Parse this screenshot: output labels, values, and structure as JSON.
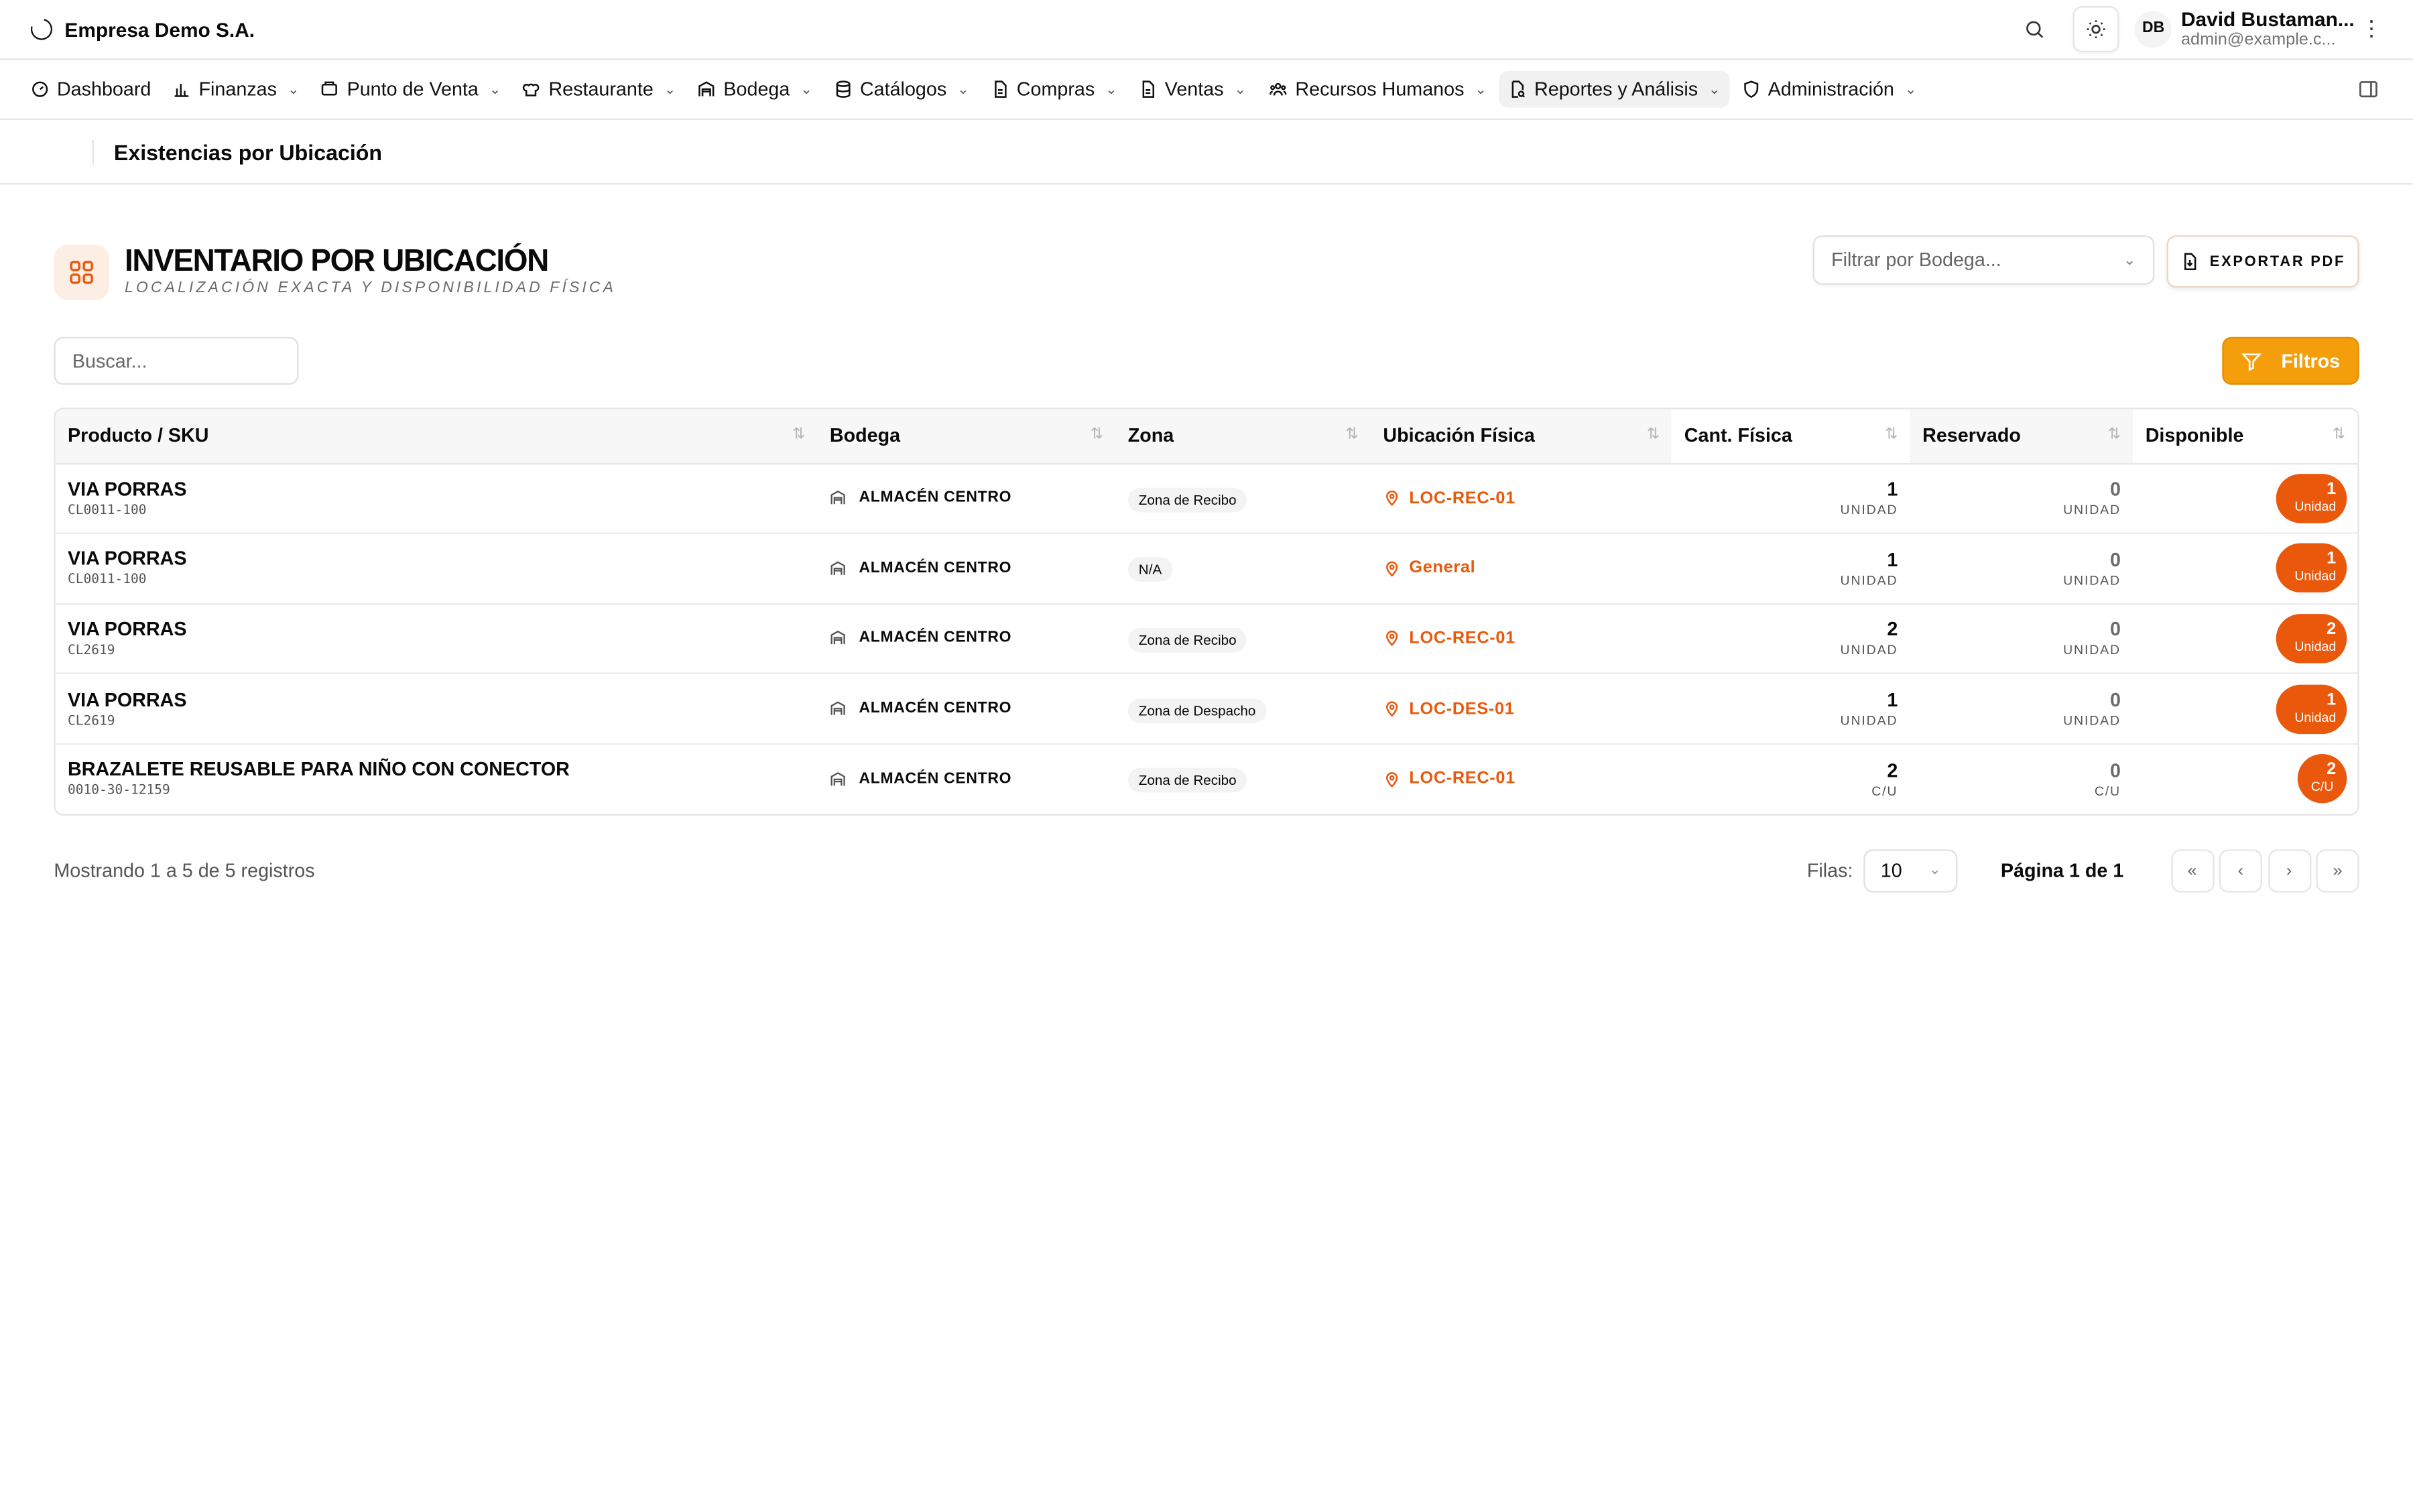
{
  "company": {
    "name": "Empresa Demo S.A."
  },
  "user": {
    "initials": "DB",
    "name": "David Bustaman...",
    "email": "admin@example.c..."
  },
  "icons": {
    "search": "search-icon",
    "theme": "sun-icon",
    "more": "kebab-icon",
    "sidebar_toggle": "sidebar-icon"
  },
  "nav": {
    "items": [
      {
        "label": "Dashboard",
        "icon": "gauge-icon"
      },
      {
        "label": "Finanzas",
        "icon": "chart-bar-icon"
      },
      {
        "label": "Punto de Venta",
        "icon": "register-icon"
      },
      {
        "label": "Restaurante",
        "icon": "chef-icon"
      },
      {
        "label": "Bodega",
        "icon": "warehouse-icon"
      },
      {
        "label": "Catálogos",
        "icon": "database-icon"
      },
      {
        "label": "Compras",
        "icon": "document-icon"
      },
      {
        "label": "Ventas",
        "icon": "document-icon"
      },
      {
        "label": "Recursos Humanos",
        "icon": "users-icon"
      },
      {
        "label": "Reportes y Análisis",
        "icon": "report-icon"
      },
      {
        "label": "Administración",
        "icon": "shield-icon"
      }
    ],
    "active": "Reportes y Análisis"
  },
  "breadcrumb": {
    "title": "Existencias por Ubicación"
  },
  "header": {
    "title": "INVENTARIO POR UBICACIÓN",
    "subtitle": "LOCALIZACIÓN EXACTA Y DISPONIBILIDAD FÍSICA",
    "filter_placeholder": "Filtrar por Bodega...",
    "export_label": "EXPORTAR PDF"
  },
  "search": {
    "placeholder": "Buscar..."
  },
  "filters_label": "Filtros",
  "table": {
    "columns": [
      "Producto / SKU",
      "Bodega",
      "Zona",
      "Ubicación Física",
      "Cant. Física",
      "Reservado",
      "Disponible"
    ],
    "rows": [
      {
        "product": "VIA PORRAS",
        "sku": "CL0011-100",
        "bodega": "ALMACÉN CENTRO",
        "zona": "Zona de Recibo",
        "ubicacion": "LOC-REC-01",
        "fisica": "1",
        "fisica_unit": "UNIDAD",
        "reservado": "0",
        "reservado_unit": "UNIDAD",
        "disponible": "1",
        "disponible_unit": "Unidad"
      },
      {
        "product": "VIA PORRAS",
        "sku": "CL0011-100",
        "bodega": "ALMACÉN CENTRO",
        "zona": "N/A",
        "ubicacion": "General",
        "fisica": "1",
        "fisica_unit": "UNIDAD",
        "reservado": "0",
        "reservado_unit": "UNIDAD",
        "disponible": "1",
        "disponible_unit": "Unidad"
      },
      {
        "product": "VIA PORRAS",
        "sku": "CL2619",
        "bodega": "ALMACÉN CENTRO",
        "zona": "Zona de Recibo",
        "ubicacion": "LOC-REC-01",
        "fisica": "2",
        "fisica_unit": "UNIDAD",
        "reservado": "0",
        "reservado_unit": "UNIDAD",
        "disponible": "2",
        "disponible_unit": "Unidad"
      },
      {
        "product": "VIA PORRAS",
        "sku": "CL2619",
        "bodega": "ALMACÉN CENTRO",
        "zona": "Zona de Despacho",
        "ubicacion": "LOC-DES-01",
        "fisica": "1",
        "fisica_unit": "UNIDAD",
        "reservado": "0",
        "reservado_unit": "UNIDAD",
        "disponible": "1",
        "disponible_unit": "Unidad"
      },
      {
        "product": "BRAZALETE REUSABLE PARA NIÑO CON CONECTOR",
        "sku": "0010-30-12159",
        "bodega": "ALMACÉN CENTRO",
        "zona": "Zona de Recibo",
        "ubicacion": "LOC-REC-01",
        "fisica": "2",
        "fisica_unit": "C/U",
        "reservado": "0",
        "reservado_unit": "C/U",
        "disponible": "2",
        "disponible_unit": "C/U"
      }
    ]
  },
  "pagination": {
    "showing": "Mostrando 1 a 5 de 5 registros",
    "rows_label": "Filas:",
    "rows_value": "10",
    "page_info": "Página 1 de 1",
    "buttons": [
      "«",
      "‹",
      "›",
      "»"
    ]
  },
  "colors": {
    "accent": "#ea580c",
    "filters": "#f59e0b",
    "brand_bg": "#fdeee4"
  }
}
